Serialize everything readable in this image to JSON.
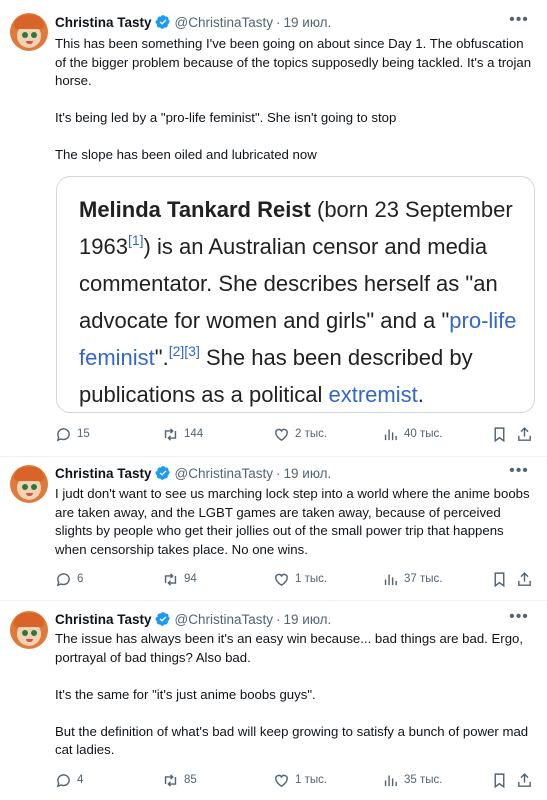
{
  "tweets": [
    {
      "author": "Christina Tasty",
      "handle": "@ChristinaTasty",
      "separator": "·",
      "date": "19 июл.",
      "paragraphs": [
        "This has been something I've been going on about since Day 1. The obfuscation of the bigger problem because of the topics supposedly being tackled. It's a trojan horse.",
        "It's being led by a \"pro-life feminist\". She isn't going to stop",
        "The slope has been oiled and lubricated now"
      ],
      "quote": {
        "name": "Melinda Tankard Reist",
        "born": " (born 23 September 1963",
        "ref1": "[1]",
        "part2": ") is an Australian censor and media commentator. She describes herself as \"an advocate for women and girls\" and a \"",
        "link1": "pro-life feminist",
        "part3": "\".",
        "ref23": "[2][3]",
        "part4": " She has been described by publications as a political ",
        "link2": "extremist",
        "part5": "."
      },
      "replies": "15",
      "retweets": "144",
      "likes": "2 тыс.",
      "views": "40 тыс."
    },
    {
      "author": "Christina Tasty",
      "handle": "@ChristinaTasty",
      "separator": "·",
      "date": "19 июл.",
      "paragraphs": [
        "I judt don't want to see us marching lock step into a world where the anime boobs are taken away, and the LGBT games are taken away, because of perceived slights by people who get their jollies out of the small power trip that happens when censorship takes place. No one wins."
      ],
      "replies": "6",
      "retweets": "94",
      "likes": "1 тыс.",
      "views": "37 тыс."
    },
    {
      "author": "Christina Tasty",
      "handle": "@ChristinaTasty",
      "separator": "·",
      "date": "19 июл.",
      "paragraphs": [
        "The issue has always been it's an easy win because... bad things are bad. Ergo, portrayal of bad things? Also bad.",
        "It's the same for \"it's just anime boobs guys\".",
        "But the definition of what's bad will keep growing to satisfy a bunch of power mad cat ladies."
      ],
      "replies": "4",
      "retweets": "85",
      "likes": "1 тыс.",
      "views": "35 тыс."
    }
  ],
  "colors": {
    "verified": "#1d9bf0",
    "secondary": "#536471",
    "link": "#3366cc"
  }
}
